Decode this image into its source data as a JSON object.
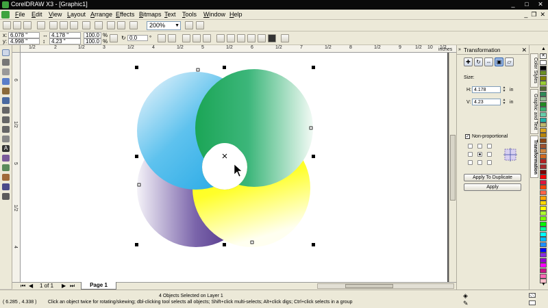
{
  "window": {
    "title": "CorelDRAW X3 - [Graphic1]"
  },
  "menu": [
    "File",
    "Edit",
    "View",
    "Layout",
    "Arrange",
    "Effects",
    "Bitmaps",
    "Text",
    "Tools",
    "Window",
    "Help"
  ],
  "standard_toolbar": {
    "zoom_level": "200%"
  },
  "property_bar": {
    "x": "6.078 \"",
    "y": "4.998 \"",
    "width": "4.178 \"",
    "height": "4.23 \"",
    "scale_x": "100.0",
    "scale_y": "100.0",
    "scale_unit": "%",
    "rotation": "0.0",
    "rotation_unit": "°"
  },
  "ruler": {
    "h_ticks": [
      "1/2",
      "2",
      "1/2",
      "3",
      "1/2",
      "4",
      "1/2",
      "5",
      "1/2",
      "6",
      "1/2",
      "7",
      "1/2",
      "8",
      "1/2",
      "9",
      "1/2",
      "10",
      "1/2"
    ],
    "unit": "inches",
    "v_ticks": [
      "6",
      "1/2",
      "5",
      "1/2",
      "4"
    ]
  },
  "page_nav": {
    "page_count": "1 of 1",
    "page_tab": "Page 1"
  },
  "status": {
    "coords": "( 6.285 , 4.338 )",
    "objects": "4 Objects Selected on Layer 1",
    "hint": "Click an object twice for rotating/skewing; dbl-clicking tool selects all objects; Shift+click multi-selects; Alt+click digs; Ctrl+click selects in a group"
  },
  "docker": {
    "title": "Transformation",
    "size_label": "Size:",
    "h_label": "H:",
    "h_value": "4.178",
    "v_label": "V:",
    "v_value": "4.23",
    "unit": "in",
    "non_proportional": "Non-proportional",
    "apply_duplicate": "Apply To Duplicate",
    "apply": "Apply"
  },
  "side_tabs": [
    "Color Styles",
    "Graphic and Text",
    "Transformation"
  ],
  "colors": {
    "blue": "#1aa3e3",
    "green": "#1ba556",
    "yellow": "#ffff00",
    "purple": "#4a2a88",
    "selection": "#000000"
  },
  "palette": [
    "#ffffff",
    "#000000",
    "#6b8e23",
    "#808000",
    "#9acd32",
    "#556b2f",
    "#2e8b57",
    "#8fbc8f",
    "#228b22",
    "#3cb371",
    "#66cdaa",
    "#20b2aa",
    "#bdb76b",
    "#daa520",
    "#b8860b",
    "#8b4513",
    "#a0522d",
    "#cd853f",
    "#d2691e",
    "#b22222",
    "#a52a2a",
    "#800000",
    "#ff0000",
    "#dc143c",
    "#ff4500",
    "#ff6347",
    "#ffa500",
    "#ffd700",
    "#ffff00",
    "#adff2f",
    "#7cfc00",
    "#00ff00",
    "#00fa9a",
    "#00ffff",
    "#00bfff",
    "#1e90ff",
    "#0000ff",
    "#8a2be2",
    "#9400d3",
    "#ff00ff",
    "#c71585",
    "#ff69b4",
    "#ffc0cb"
  ]
}
